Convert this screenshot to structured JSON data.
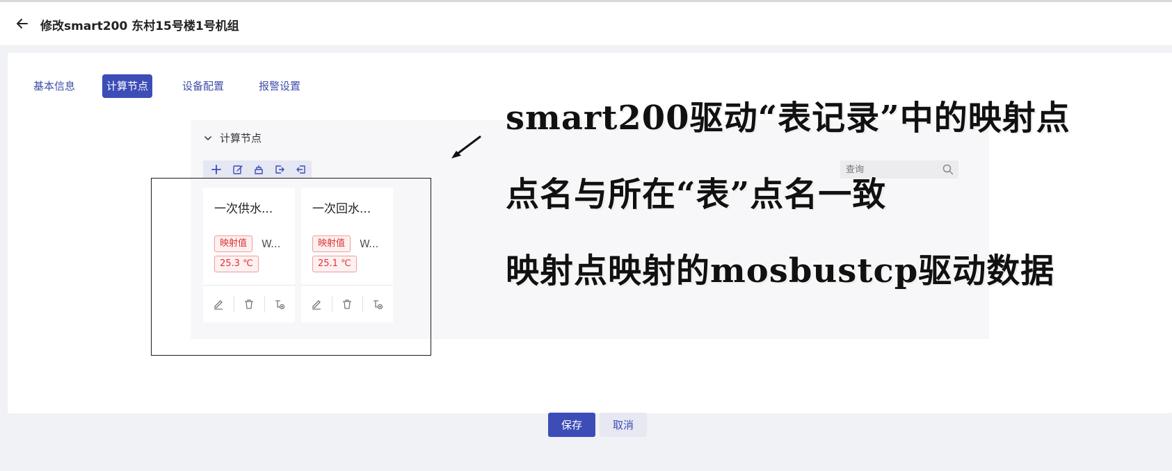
{
  "header": {
    "title": "修改smart200 东村15号楼1号机组"
  },
  "tabs": [
    {
      "label": "基本信息",
      "active": false
    },
    {
      "label": "计算节点",
      "active": true
    },
    {
      "label": "设备配置",
      "active": false
    },
    {
      "label": "报警设置",
      "active": false
    }
  ],
  "panel": {
    "title": "计算节点",
    "search_placeholder": "查询",
    "toolbar_icons": [
      "plus-icon",
      "edit-icon",
      "import-icon",
      "export-icon",
      "logout-icon"
    ]
  },
  "nodes": [
    {
      "name": "一次供水...",
      "tag": "映射值",
      "sub": "W...",
      "value": "25.3 ℃"
    },
    {
      "name": "一次回水...",
      "tag": "映射值",
      "sub": "W...",
      "value": "25.1 ℃"
    }
  ],
  "annotation": {
    "line1": "smart200驱动“表记录”中的映射点",
    "line2": "点名与所在“表”点名一致",
    "line3": "映射点映射的mosbustcp驱动数据"
  },
  "footer": {
    "save_label": "保存",
    "cancel_label": "取消"
  },
  "colors": {
    "accent": "#3d4db7",
    "tag_red": "#e03232",
    "background": "#f1f2f6"
  }
}
